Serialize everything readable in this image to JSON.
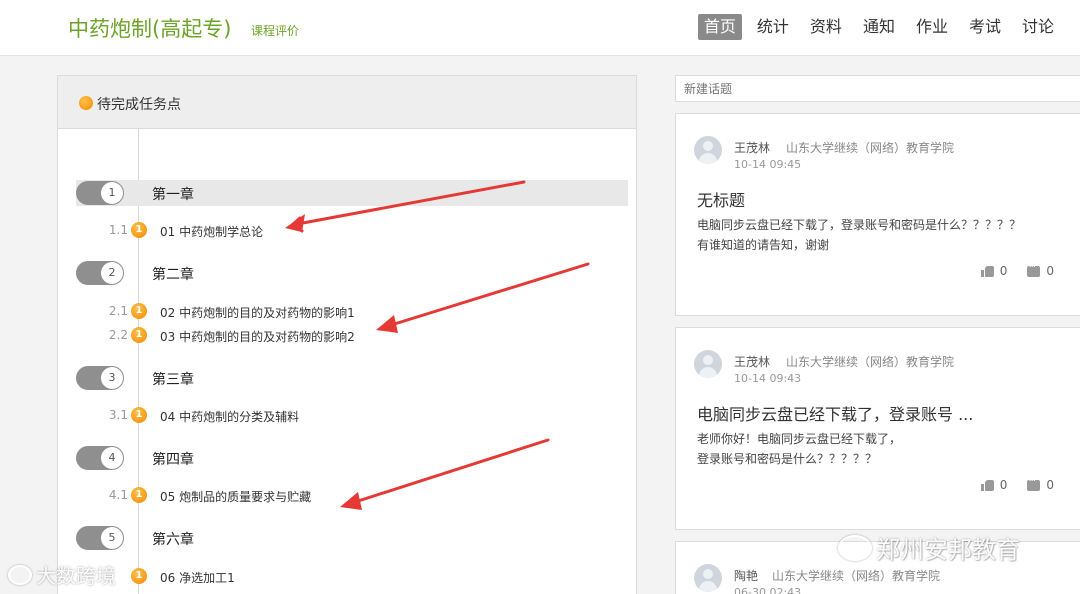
{
  "header": {
    "course_title": "中药炮制(高起专)",
    "course_eval": "课程评价",
    "nav": [
      "首页",
      "统计",
      "资料",
      "通知",
      "作业",
      "考试",
      "讨论"
    ],
    "active_nav": "首页"
  },
  "left_panel": {
    "title": "待完成任务点",
    "chapters": [
      {
        "num": "1",
        "title": "第一章"
      },
      {
        "num": "2",
        "title": "第二章"
      },
      {
        "num": "3",
        "title": "第三章"
      },
      {
        "num": "4",
        "title": "第四章"
      },
      {
        "num": "5",
        "title": "第六章"
      }
    ],
    "tasks": [
      {
        "num": "1.1",
        "badge": "1",
        "title": "01 中药炮制学总论"
      },
      {
        "num": "2.1",
        "badge": "1",
        "title": "02 中药炮制的目的及对药物的影响1"
      },
      {
        "num": "2.2",
        "badge": "1",
        "title": "03 中药炮制的目的及对药物的影响2"
      },
      {
        "num": "3.1",
        "badge": "1",
        "title": "04 中药炮制的分类及辅料"
      },
      {
        "num": "4.1",
        "badge": "1",
        "title": "05 炮制品的质量要求与贮藏"
      },
      {
        "num": "",
        "badge": "1",
        "title": "06 净选加工1"
      }
    ]
  },
  "right_panel": {
    "new_topic_placeholder": "新建话题",
    "posts": [
      {
        "author": "王茂林",
        "school": "山东大学继续（网络）教育学院",
        "time": "10-14 09:45",
        "title": "无标题",
        "body_line1": "电脑同步云盘已经下载了，登录账号和密码是什么？？？？？",
        "body_line2": "有谁知道的请告知，谢谢",
        "likes": "0",
        "comments": "0"
      },
      {
        "author": "王茂林",
        "school": "山东大学继续（网络）教育学院",
        "time": "10-14 09:43",
        "title": "电脑同步云盘已经下载了，登录账号 ...",
        "body_line1": "老师你好！电脑同步云盘已经下载了，",
        "body_line2": "登录账号和密码是什么？？？？？",
        "likes": "0",
        "comments": "0"
      },
      {
        "author": "陶艳",
        "school": "山东大学继续（网络）教育学院",
        "time": "06-30 02:43"
      }
    ]
  },
  "watermarks": {
    "right": "郑州安邦教育",
    "left": "大数跨境"
  },
  "colors": {
    "brand_green": "#6ea32a",
    "active_nav_bg": "#8a8a8a",
    "task_orange": "#f08a00",
    "annotation_red": "#e53935"
  }
}
